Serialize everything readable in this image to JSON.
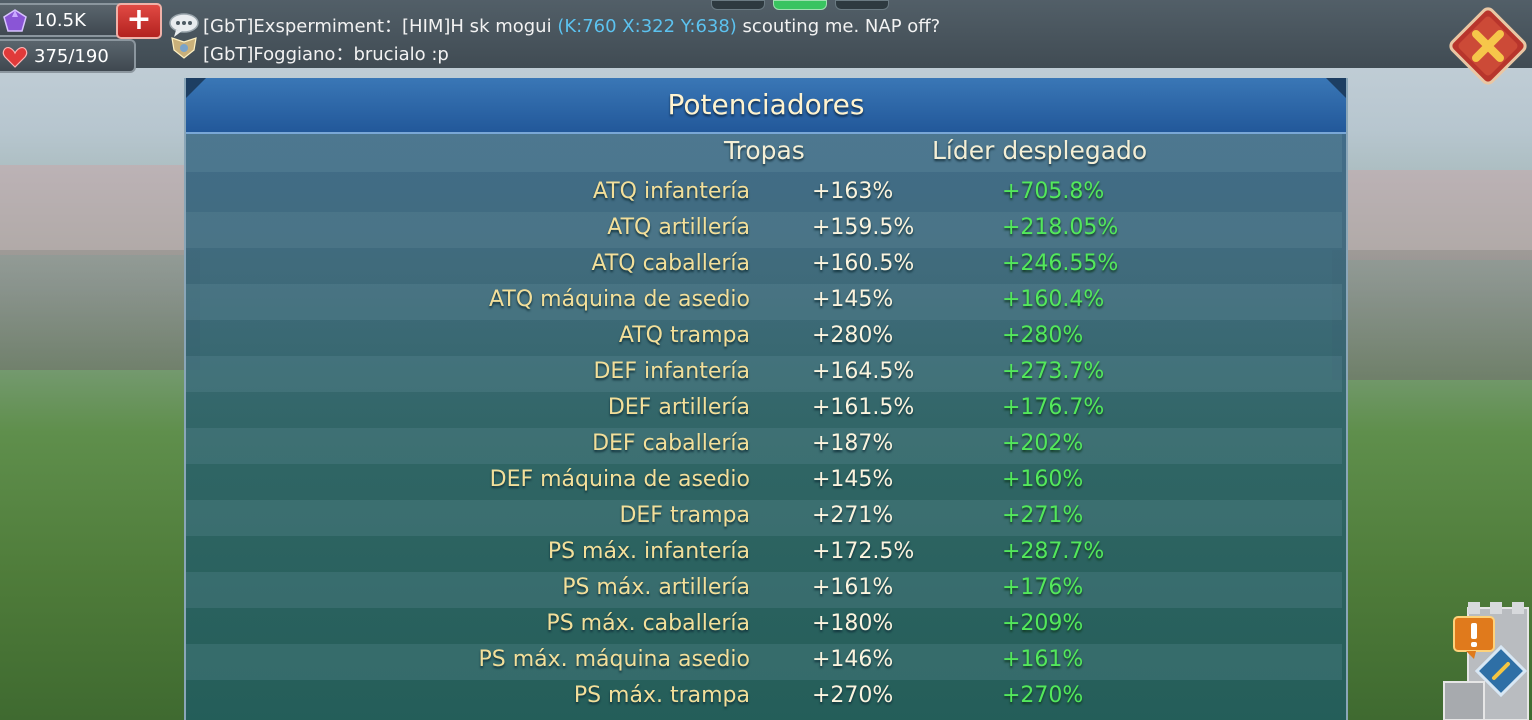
{
  "resources": {
    "gems": "10.5K",
    "stamina": "375/190",
    "add_label": "+"
  },
  "chat": {
    "line1_prefix": "[GbT]Exspermiment：[HIM]H sk mogui ",
    "line1_coords": "(K:760 X:322 Y:638)",
    "line1_suffix": " scouting me. NAP off?",
    "line2": "[GbT]Foggiano：brucialo :p"
  },
  "panel": {
    "title": "Potenciadores",
    "col_troops": "Tropas",
    "col_leader": "Líder desplegado",
    "rows": [
      {
        "label": "ATQ infantería",
        "troops": "+163%",
        "leader": "+705.8%"
      },
      {
        "label": "ATQ artillería",
        "troops": "+159.5%",
        "leader": "+218.05%"
      },
      {
        "label": "ATQ caballería",
        "troops": "+160.5%",
        "leader": "+246.55%"
      },
      {
        "label": "ATQ máquina de asedio",
        "troops": "+145%",
        "leader": "+160.4%"
      },
      {
        "label": "ATQ trampa",
        "troops": "+280%",
        "leader": "+280%"
      },
      {
        "label": "DEF infantería",
        "troops": "+164.5%",
        "leader": "+273.7%"
      },
      {
        "label": "DEF artillería",
        "troops": "+161.5%",
        "leader": "+176.7%"
      },
      {
        "label": "DEF caballería",
        "troops": "+187%",
        "leader": "+202%"
      },
      {
        "label": "DEF máquina de asedio",
        "troops": "+145%",
        "leader": "+160%"
      },
      {
        "label": "DEF trampa",
        "troops": "+271%",
        "leader": "+271%"
      },
      {
        "label": "PS máx. infantería",
        "troops": "+172.5%",
        "leader": "+287.7%"
      },
      {
        "label": "PS máx. artillería",
        "troops": "+161%",
        "leader": "+176%"
      },
      {
        "label": "PS máx. caballería",
        "troops": "+180%",
        "leader": "+209%"
      },
      {
        "label": "PS máx. máquina asedio",
        "troops": "+146%",
        "leader": "+161%"
      },
      {
        "label": "PS máx. trampa",
        "troops": "+270%",
        "leader": "+270%"
      }
    ]
  },
  "icons": {
    "gem": "gem-icon",
    "heart": "heart-icon",
    "chat": "chat-bubble-icon",
    "guild": "guild-badge-icon",
    "close": "close-icon",
    "alert": "alert-icon"
  },
  "colors": {
    "leader_value": "#53e85b",
    "coords": "#5cc2ef",
    "label": "#f3df9a",
    "close_button": "#c0392b"
  }
}
